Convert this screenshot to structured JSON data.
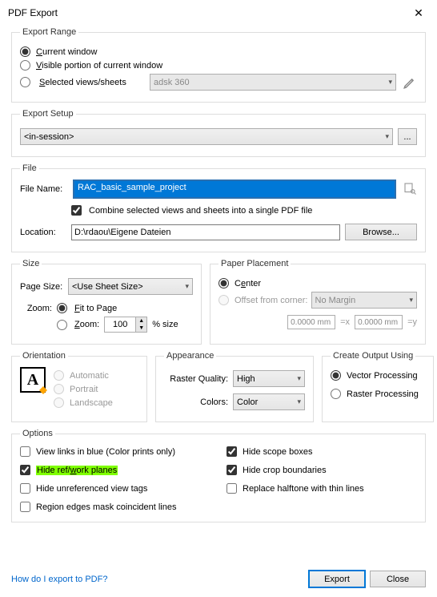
{
  "window": {
    "title": "PDF Export"
  },
  "exportRange": {
    "legend": "Export Range",
    "current": "Current window",
    "visible": "Visible portion of current window",
    "selected": "Selected views/sheets",
    "setDropdown": "adsk 360"
  },
  "exportSetup": {
    "legend": "Export Setup",
    "value": "<in-session>",
    "more": "..."
  },
  "file": {
    "legend": "File",
    "fileNameLabel": "File Name:",
    "fileName": "RAC_basic_sample_project",
    "combineLabel": "Combine selected views and sheets into a single PDF file",
    "locationLabel": "Location:",
    "location": "D:\\rdaou\\Eigene Dateien",
    "browse": "Browse..."
  },
  "size": {
    "legend": "Size",
    "pageSizeLabel": "Page Size:",
    "pageSize": "<Use Sheet Size>",
    "zoomLabel": "Zoom:",
    "fit": "Fit to Page",
    "zoomRadio": "Zoom:",
    "zoomValue": "100",
    "pctSize": "% size"
  },
  "paper": {
    "legend": "Paper Placement",
    "center": "Center",
    "offset": "Offset from corner:",
    "margin": "No Margin",
    "x": "0.0000 mm",
    "y": "0.0000 mm",
    "eqx": "=x",
    "eqy": "=y"
  },
  "orientation": {
    "legend": "Orientation",
    "auto": "Automatic",
    "portrait": "Portrait",
    "landscape": "Landscape"
  },
  "appearance": {
    "legend": "Appearance",
    "rasterLabel": "Raster Quality:",
    "raster": "High",
    "colorsLabel": "Colors:",
    "colors": "Color"
  },
  "output": {
    "legend": "Create Output Using",
    "vector": "Vector Processing",
    "raster": "Raster Processing"
  },
  "options": {
    "legend": "Options",
    "viewLinks": "View links in blue (Color prints only)",
    "hideScope": "Hide scope boxes",
    "hideRef": "Hide ref/work planes",
    "hideCrop": "Hide crop boundaries",
    "hideUnref": "Hide unreferenced view tags",
    "replaceHalftone": "Replace halftone with thin lines",
    "regionEdges": "Region edges mask coincident lines"
  },
  "footer": {
    "help": "How do I export to PDF?",
    "export": "Export",
    "close": "Close"
  }
}
